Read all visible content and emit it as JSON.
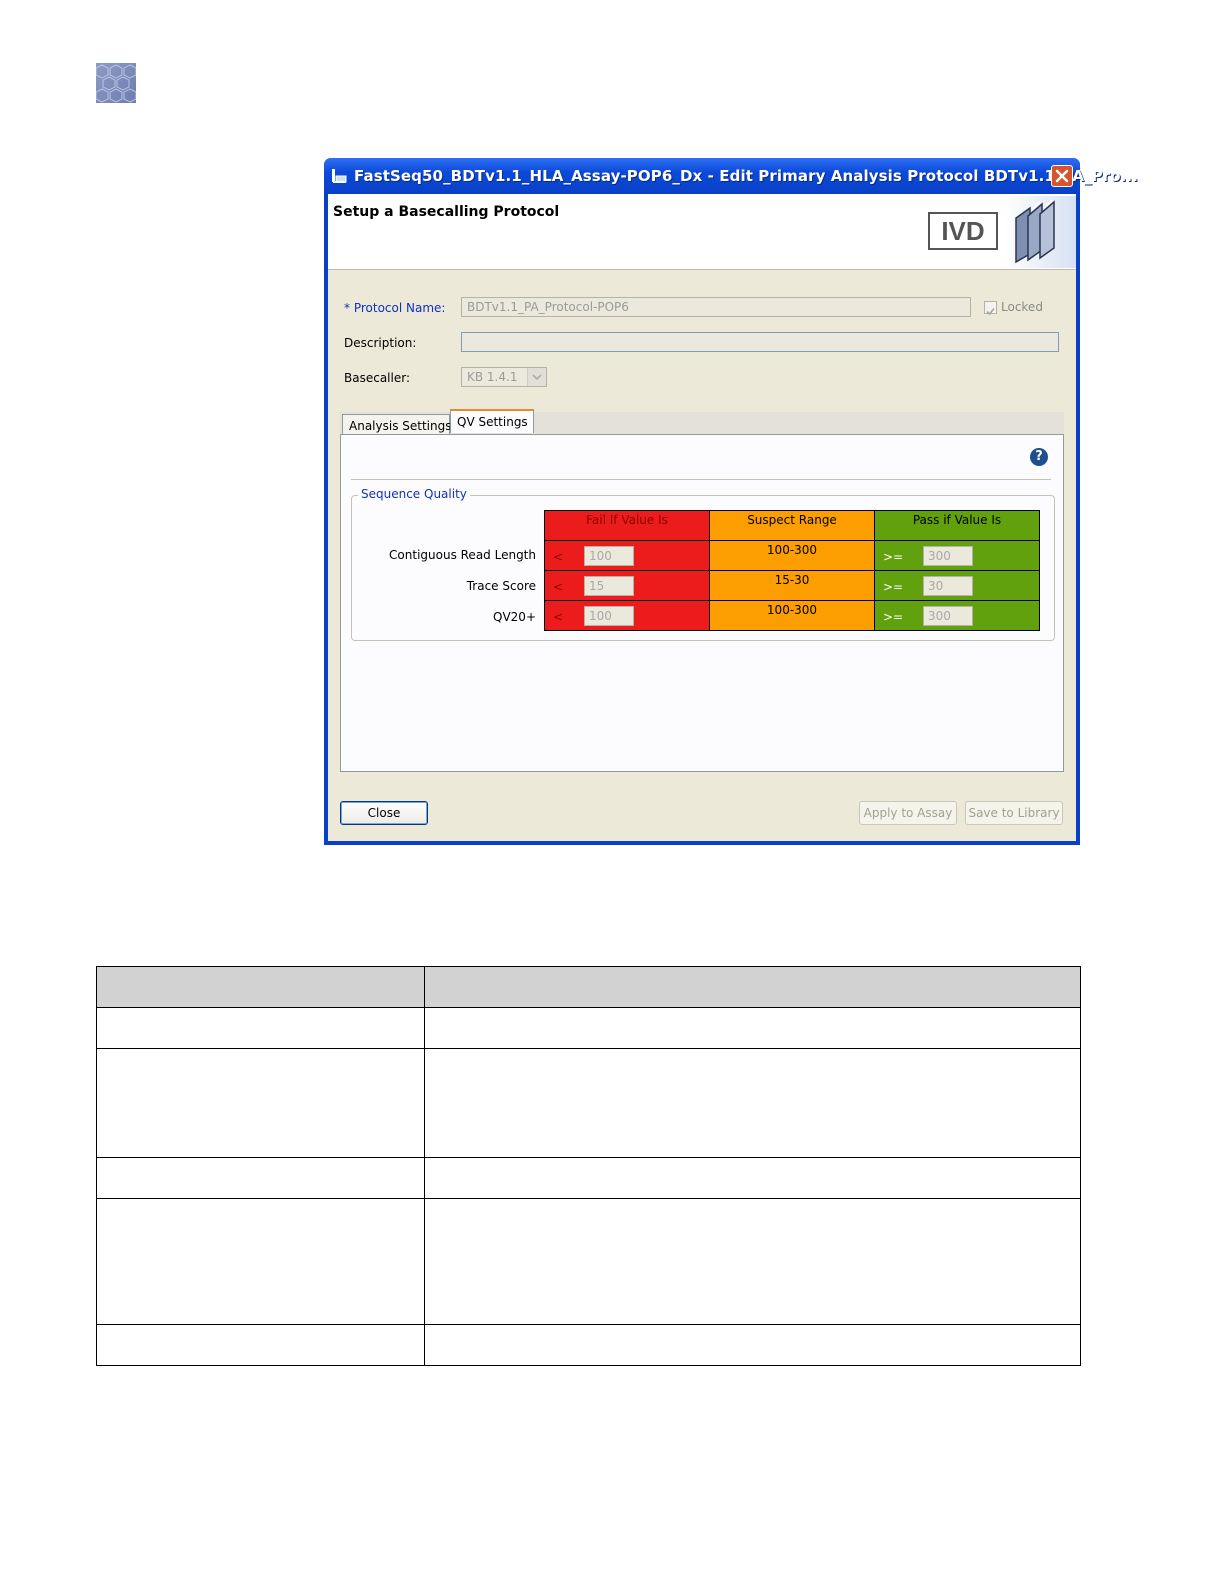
{
  "window": {
    "title": "FastSeq50_BDTv1.1_HLA_Assay-POP6_Dx - Edit Primary Analysis Protocol BDTv1.1_PA_Pro...",
    "accent_color": "#0a3fc8"
  },
  "header": {
    "title": "Setup a Basecalling Protocol",
    "badge": "IVD"
  },
  "form": {
    "required_marker": "*",
    "protocol_name_label": "Protocol Name:",
    "protocol_name_value": "BDTv1.1_PA_Protocol-POP6",
    "locked_label": "Locked",
    "locked_checked": true,
    "description_label": "Description:",
    "description_value": "",
    "basecaller_label": "Basecaller:",
    "basecaller_value": "KB 1.4.1"
  },
  "tabs": [
    {
      "label": "Analysis Settings",
      "active": false
    },
    {
      "label": "QV Settings",
      "active": true
    }
  ],
  "qv": {
    "group_title": "Sequence Quality",
    "headers": {
      "fail": "Fail If Value Is",
      "suspect": "Suspect Range",
      "pass": "Pass if Value Is"
    },
    "colors": {
      "fail": "#ec1c1c",
      "suspect": "#fd9e00",
      "pass": "#61a10d"
    },
    "rows": [
      {
        "label": "Contiguous Read Length",
        "fail_op": "<",
        "fail_value": "100",
        "suspect": "100-300",
        "pass_op": ">=",
        "pass_value": "300"
      },
      {
        "label": "Trace Score",
        "fail_op": "<",
        "fail_value": "15",
        "suspect": "15-30",
        "pass_op": ">=",
        "pass_value": "30"
      },
      {
        "label": "QV20+",
        "fail_op": "<",
        "fail_value": "100",
        "suspect": "100-300",
        "pass_op": ">=",
        "pass_value": "300"
      }
    ]
  },
  "buttons": {
    "close": "Close",
    "apply": "Apply to Assay",
    "save": "Save to Library"
  },
  "icons": [
    "logo-icon",
    "app-icon",
    "close-icon",
    "checkbox-checked-icon",
    "chevron-down-icon",
    "help-icon",
    "library-books-icon"
  ]
}
